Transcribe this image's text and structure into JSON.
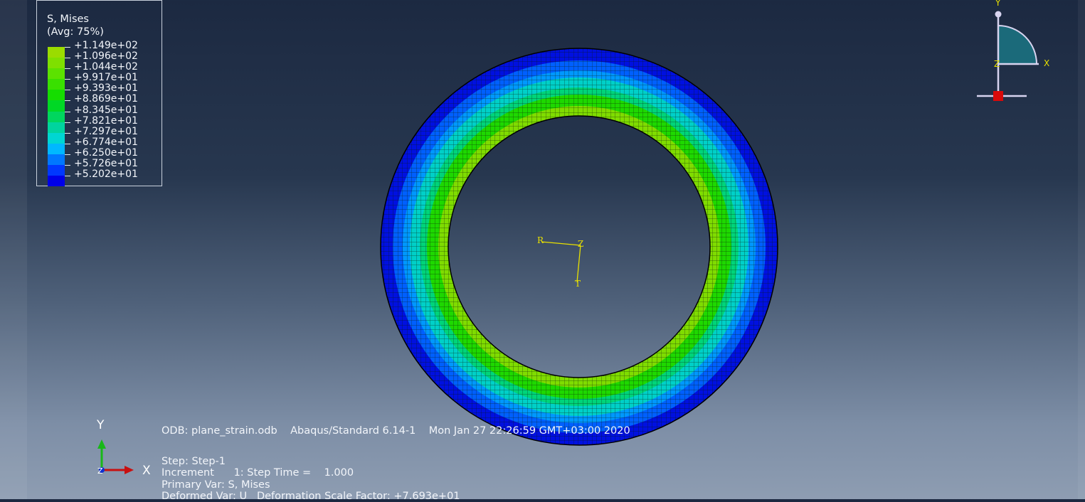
{
  "legend": {
    "title": "S, Mises",
    "subtitle": "(Avg: 75%)",
    "values": [
      "+1.149e+02",
      "+1.096e+02",
      "+1.044e+02",
      "+9.917e+01",
      "+9.393e+01",
      "+8.869e+01",
      "+8.345e+01",
      "+7.821e+01",
      "+7.297e+01",
      "+6.774e+01",
      "+6.250e+01",
      "+5.726e+01",
      "+5.202e+01"
    ],
    "colors": [
      "#9bdc00",
      "#7fe000",
      "#5ce200",
      "#39e000",
      "#15dd00",
      "#00d825",
      "#00d65e",
      "#00d49e",
      "#00d6d2",
      "#00b8ff",
      "#0077ff",
      "#0038ff",
      "#0000e8"
    ]
  },
  "info": {
    "odb_line": "ODB: plane_strain.odb    Abaqus/Standard 6.14-1    Mon Jan 27 22:26:59 GMT+03:00 2020",
    "step_line": "Step: Step-1",
    "increment_line": "Increment      1: Step Time =    1.000",
    "primary_var_line": "Primary Var: S, Mises",
    "deformed_var_line": "Deformed Var: U   Deformation Scale Factor: +7.693e+01"
  },
  "csys": {
    "r": "R",
    "z": "Z",
    "t": "T"
  },
  "global_triad": {
    "x": "X",
    "y": "Y",
    "z": "Z"
  },
  "view_triad": {
    "x": "X",
    "y": "Y",
    "z": "Z"
  },
  "colors": {
    "outer_ring": "#0010e0",
    "mid_blue": "#0060ff",
    "cyan": "#00d0c8",
    "green": "#1ed800",
    "inner_green": "#7fdc00",
    "csys_yellow": "#e8e000",
    "quarter_fill": "#1b6a7a"
  }
}
